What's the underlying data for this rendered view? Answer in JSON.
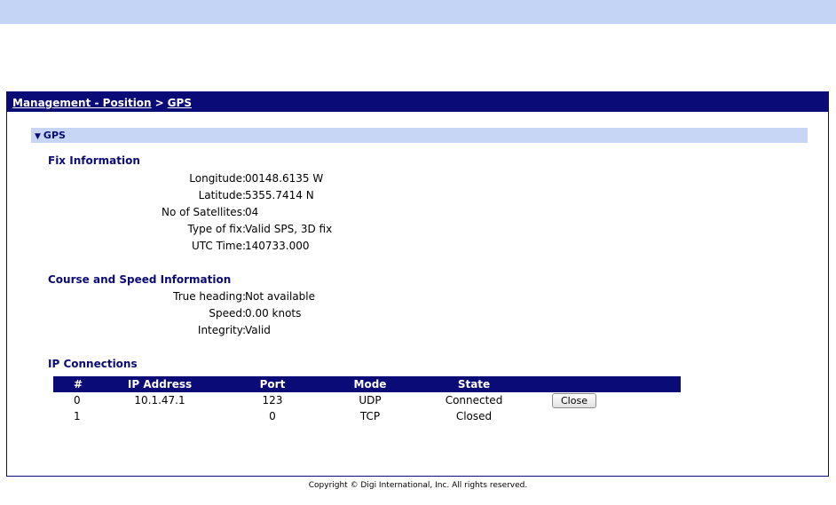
{
  "breadcrumb": {
    "parent": "Management - Position",
    "separator": ">",
    "current": "GPS"
  },
  "section": {
    "title": "GPS"
  },
  "fix_info": {
    "title": "Fix Information",
    "rows": [
      {
        "label": "Longitude:",
        "value": "00148.6135 W"
      },
      {
        "label": "Latitude:",
        "value": "5355.7414 N"
      },
      {
        "label": "No of Satellites:",
        "value": "04"
      },
      {
        "label": "Type of fix:",
        "value": "Valid SPS, 3D fix"
      },
      {
        "label": "UTC Time:",
        "value": "140733.000"
      }
    ]
  },
  "course_info": {
    "title": "Course and Speed Information",
    "rows": [
      {
        "label": "True heading:",
        "value": "Not available"
      },
      {
        "label": "Speed:",
        "value": "0.00 knots"
      },
      {
        "label": "Integrity:",
        "value": "Valid"
      }
    ]
  },
  "ip_connections": {
    "title": "IP Connections",
    "headers": [
      "#",
      "IP Address",
      "Port",
      "Mode",
      "State"
    ],
    "rows": [
      {
        "num": "0",
        "ip": "10.1.47.1",
        "port": "123",
        "mode": "UDP",
        "state": "Connected",
        "action": "Close"
      },
      {
        "num": "1",
        "ip": "",
        "port": "0",
        "mode": "TCP",
        "state": "Closed",
        "action": ""
      }
    ]
  },
  "footer": {
    "text": "Copyright © Digi International, Inc. All rights reserved."
  },
  "colors": {
    "navy": "#0b0b77",
    "section_bg": "#c8d6f5",
    "top_band": "#c4d4f4"
  }
}
